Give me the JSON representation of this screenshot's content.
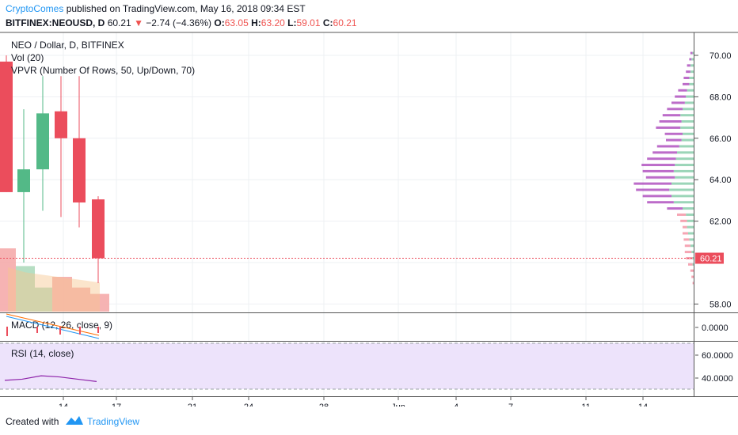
{
  "header": {
    "author": "CryptoComes",
    "published_text": "published on TradingView.com, May 16, 2018 09:34 EST",
    "symbol": "BITFINEX:NEOUSD, D",
    "last": "60.21",
    "change": "−2.74 (−4.36%)",
    "o_label": "O:",
    "o_value": "63.05",
    "h_label": "H:",
    "h_value": "63.20",
    "l_label": "L:",
    "l_value": "59.01",
    "c_label": "C:",
    "c_value": "60.21"
  },
  "legend": {
    "title": "NEO / Dollar, D, BITFINEX",
    "vol": "Vol (20)",
    "vpvr": "VPVR (Number Of Rows, 50, Up/Down, 70)"
  },
  "price_axis": {
    "ticks": [
      "70.00",
      "68.00",
      "66.00",
      "64.00",
      "62.00",
      "58.00"
    ],
    "tick_values": [
      70,
      68,
      66,
      64,
      62,
      58
    ],
    "last_label": "60.21",
    "last_value": 60.21
  },
  "time_axis": {
    "labels": [
      "14",
      "17",
      "21",
      "24",
      "28",
      "Jun",
      "4",
      "7",
      "11",
      "14"
    ]
  },
  "macd": {
    "label": "MACD (12, 26, close, 9)",
    "ticks": [
      "0.0000"
    ]
  },
  "rsi": {
    "label": "RSI (14, close)",
    "ticks": [
      "60.0000",
      "40.0000"
    ],
    "values": [
      38,
      39,
      42,
      41,
      39,
      37
    ]
  },
  "footer": {
    "created_with": "Created with",
    "brand": "TradingView"
  },
  "colors": {
    "up": "#53b987",
    "down": "#eb4d5c",
    "accent": "#2196f3"
  },
  "chart_data": {
    "type": "candlestick",
    "title": "NEO / Dollar, D, BITFINEX",
    "ylim": [
      57.6,
      71
    ],
    "candles": [
      {
        "open": 69.7,
        "high": 70.0,
        "low": 63.4,
        "close": 63.4
      },
      {
        "open": 63.4,
        "high": 67.4,
        "low": 60.0,
        "close": 64.5
      },
      {
        "open": 64.5,
        "high": 69.0,
        "low": 62.5,
        "close": 67.2
      },
      {
        "open": 67.3,
        "high": 69.0,
        "low": 62.2,
        "close": 66.0
      },
      {
        "open": 66.0,
        "high": 69.0,
        "low": 61.7,
        "close": 62.9
      },
      {
        "open": 63.05,
        "high": 63.2,
        "low": 59.01,
        "close": 60.21
      }
    ],
    "volume": [
      {
        "value": 1.0,
        "up": false
      },
      {
        "value": 0.72,
        "up": true
      },
      {
        "value": 0.38,
        "up": true
      },
      {
        "value": 0.55,
        "up": false
      },
      {
        "value": 0.38,
        "up": false
      },
      {
        "value": 0.28,
        "up": false
      }
    ],
    "volume_ma": [
      0.7,
      0.62,
      0.58,
      0.54,
      0.5,
      0.46
    ],
    "vpvr": [
      {
        "price": 70.1,
        "up": 0.01,
        "down": 0.02
      },
      {
        "price": 69.8,
        "up": 0.02,
        "down": 0.02
      },
      {
        "price": 69.5,
        "up": 0.03,
        "down": 0.03
      },
      {
        "price": 69.2,
        "up": 0.03,
        "down": 0.04
      },
      {
        "price": 68.9,
        "up": 0.04,
        "down": 0.05
      },
      {
        "price": 68.6,
        "up": 0.04,
        "down": 0.06
      },
      {
        "price": 68.3,
        "up": 0.06,
        "down": 0.08
      },
      {
        "price": 68.0,
        "up": 0.07,
        "down": 0.1
      },
      {
        "price": 67.7,
        "up": 0.08,
        "down": 0.12
      },
      {
        "price": 67.4,
        "up": 0.1,
        "down": 0.14
      },
      {
        "price": 67.1,
        "up": 0.12,
        "down": 0.16
      },
      {
        "price": 66.8,
        "up": 0.11,
        "down": 0.2
      },
      {
        "price": 66.5,
        "up": 0.12,
        "down": 0.22
      },
      {
        "price": 66.2,
        "up": 0.1,
        "down": 0.16
      },
      {
        "price": 65.9,
        "up": 0.11,
        "down": 0.14
      },
      {
        "price": 65.6,
        "up": 0.13,
        "down": 0.2
      },
      {
        "price": 65.3,
        "up": 0.15,
        "down": 0.22
      },
      {
        "price": 65.0,
        "up": 0.16,
        "down": 0.26
      },
      {
        "price": 64.7,
        "up": 0.17,
        "down": 0.3
      },
      {
        "price": 64.4,
        "up": 0.18,
        "down": 0.28
      },
      {
        "price": 64.1,
        "up": 0.17,
        "down": 0.26
      },
      {
        "price": 63.8,
        "up": 0.2,
        "down": 0.34
      },
      {
        "price": 63.5,
        "up": 0.22,
        "down": 0.3
      },
      {
        "price": 63.2,
        "up": 0.2,
        "down": 0.26
      },
      {
        "price": 62.9,
        "up": 0.18,
        "down": 0.24
      },
      {
        "price": 62.6,
        "up": 0.1,
        "down": 0.14
      },
      {
        "price": 62.3,
        "up": 0.07,
        "down": 0.08
      },
      {
        "price": 62.0,
        "up": 0.06,
        "down": 0.06
      },
      {
        "price": 61.7,
        "up": 0.06,
        "down": 0.04
      },
      {
        "price": 61.4,
        "up": 0.05,
        "down": 0.05
      },
      {
        "price": 61.1,
        "up": 0.04,
        "down": 0.05
      },
      {
        "price": 60.8,
        "up": 0.03,
        "down": 0.05
      },
      {
        "price": 60.5,
        "up": 0.02,
        "down": 0.06
      },
      {
        "price": 60.2,
        "up": 0.01,
        "down": 0.06
      },
      {
        "price": 59.9,
        "up": 0.01,
        "down": 0.04
      },
      {
        "price": 59.6,
        "up": 0.0,
        "down": 0.03
      },
      {
        "price": 59.3,
        "up": 0.0,
        "down": 0.02
      },
      {
        "price": 59.0,
        "up": 0.0,
        "down": 0.01
      }
    ],
    "ylabel": "",
    "xlabel": ""
  }
}
